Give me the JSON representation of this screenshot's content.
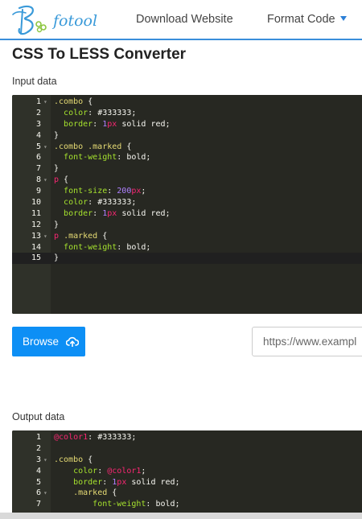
{
  "nav": {
    "logo_text": "fotool",
    "download_label": "Download Website",
    "format_label": "Format Code"
  },
  "page": {
    "title": "CSS To LESS Converter",
    "input_label": "Input data",
    "output_label": "Output data"
  },
  "controls": {
    "browse_label": "Browse",
    "url_placeholder": "https://www.exampl"
  },
  "input_code": [
    {
      "n": "1",
      "fold": true,
      "parts": [
        {
          "t": ".combo",
          "c": "sel"
        },
        {
          "t": " {",
          "c": "punct"
        }
      ]
    },
    {
      "n": "2",
      "parts": [
        {
          "t": "  ",
          "c": "punct"
        },
        {
          "t": "color",
          "c": "prop"
        },
        {
          "t": ": #333333;",
          "c": "val"
        }
      ]
    },
    {
      "n": "3",
      "parts": [
        {
          "t": "  ",
          "c": "punct"
        },
        {
          "t": "border",
          "c": "prop"
        },
        {
          "t": ": ",
          "c": "val"
        },
        {
          "t": "1",
          "c": "num"
        },
        {
          "t": "px",
          "c": "unit"
        },
        {
          "t": " solid red;",
          "c": "val"
        }
      ]
    },
    {
      "n": "4",
      "parts": [
        {
          "t": "}",
          "c": "punct"
        }
      ]
    },
    {
      "n": "5",
      "fold": true,
      "parts": [
        {
          "t": ".combo .marked",
          "c": "sel"
        },
        {
          "t": " {",
          "c": "punct"
        }
      ]
    },
    {
      "n": "6",
      "parts": [
        {
          "t": "  ",
          "c": "punct"
        },
        {
          "t": "font-weight",
          "c": "prop"
        },
        {
          "t": ": bold;",
          "c": "val"
        }
      ]
    },
    {
      "n": "7",
      "parts": [
        {
          "t": "}",
          "c": "punct"
        }
      ]
    },
    {
      "n": "8",
      "fold": true,
      "parts": [
        {
          "t": "p",
          "c": "kw"
        },
        {
          "t": " {",
          "c": "punct"
        }
      ]
    },
    {
      "n": "9",
      "parts": [
        {
          "t": "  ",
          "c": "punct"
        },
        {
          "t": "font-size",
          "c": "prop"
        },
        {
          "t": ": ",
          "c": "val"
        },
        {
          "t": "200",
          "c": "num"
        },
        {
          "t": "px",
          "c": "unit"
        },
        {
          "t": ";",
          "c": "val"
        }
      ]
    },
    {
      "n": "10",
      "parts": [
        {
          "t": "  ",
          "c": "punct"
        },
        {
          "t": "color",
          "c": "prop"
        },
        {
          "t": ": #333333;",
          "c": "val"
        }
      ]
    },
    {
      "n": "11",
      "parts": [
        {
          "t": "  ",
          "c": "punct"
        },
        {
          "t": "border",
          "c": "prop"
        },
        {
          "t": ": ",
          "c": "val"
        },
        {
          "t": "1",
          "c": "num"
        },
        {
          "t": "px",
          "c": "unit"
        },
        {
          "t": " solid red;",
          "c": "val"
        }
      ]
    },
    {
      "n": "12",
      "parts": [
        {
          "t": "}",
          "c": "punct"
        }
      ]
    },
    {
      "n": "13",
      "fold": true,
      "parts": [
        {
          "t": "p",
          "c": "kw"
        },
        {
          "t": " ",
          "c": "punct"
        },
        {
          "t": ".marked",
          "c": "sel"
        },
        {
          "t": " {",
          "c": "punct"
        }
      ]
    },
    {
      "n": "14",
      "parts": [
        {
          "t": "  ",
          "c": "punct"
        },
        {
          "t": "font-weight",
          "c": "prop"
        },
        {
          "t": ": bold;",
          "c": "val"
        }
      ]
    },
    {
      "n": "15",
      "active": true,
      "parts": [
        {
          "t": "}",
          "c": "punct"
        }
      ]
    }
  ],
  "output_code": [
    {
      "n": "1",
      "parts": [
        {
          "t": "@color1",
          "c": "var"
        },
        {
          "t": ": #333333;",
          "c": "val"
        }
      ]
    },
    {
      "n": "2",
      "parts": []
    },
    {
      "n": "3",
      "fold": true,
      "parts": [
        {
          "t": ".combo",
          "c": "sel"
        },
        {
          "t": " {",
          "c": "punct"
        }
      ]
    },
    {
      "n": "4",
      "parts": [
        {
          "t": "    ",
          "c": "punct"
        },
        {
          "t": "color",
          "c": "prop"
        },
        {
          "t": ": ",
          "c": "val"
        },
        {
          "t": "@color1",
          "c": "var"
        },
        {
          "t": ";",
          "c": "val"
        }
      ]
    },
    {
      "n": "5",
      "parts": [
        {
          "t": "    ",
          "c": "punct"
        },
        {
          "t": "border",
          "c": "prop"
        },
        {
          "t": ": ",
          "c": "val"
        },
        {
          "t": "1",
          "c": "num"
        },
        {
          "t": "px",
          "c": "unit"
        },
        {
          "t": " solid red;",
          "c": "val"
        }
      ]
    },
    {
      "n": "6",
      "fold": true,
      "parts": [
        {
          "t": "    ",
          "c": "punct"
        },
        {
          "t": ".marked",
          "c": "sel"
        },
        {
          "t": " {",
          "c": "punct"
        }
      ]
    },
    {
      "n": "7",
      "parts": [
        {
          "t": "        ",
          "c": "punct"
        },
        {
          "t": "font-weight",
          "c": "prop"
        },
        {
          "t": ": bold;",
          "c": "val"
        }
      ]
    }
  ],
  "colors": {
    "brand": "#3a9ad9",
    "button": "#0d8ff5",
    "editor_bg": "#272822"
  }
}
